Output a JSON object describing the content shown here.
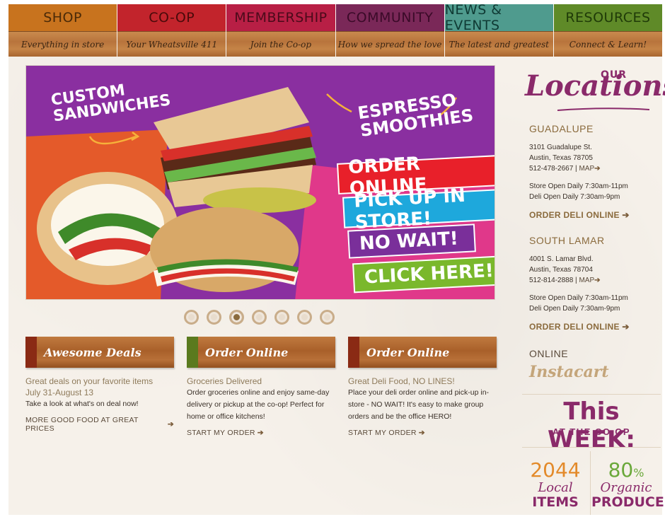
{
  "nav": [
    {
      "label": "SHOP",
      "sub": "Everything in store",
      "color": "#c8731e",
      "text_color": "#4a2a08"
    },
    {
      "label": "CO-OP",
      "sub": "Your Wheatsville 411",
      "color": "#c2242c",
      "text_color": "#4a0a0a"
    },
    {
      "label": "MEMBERSHIP",
      "sub": "Join the Co-op",
      "color": "#b81f45",
      "text_color": "#4a0a1a"
    },
    {
      "label": "COMMUNITY",
      "sub": "How we spread the love",
      "color": "#7a2858",
      "text_color": "#3a0a28"
    },
    {
      "label": "NEWS & EVENTS",
      "sub": "The latest and greatest",
      "color": "#4f9b8e",
      "text_color": "#0f3a34"
    },
    {
      "label": "RESOURCES",
      "sub": "Connect & Learn!",
      "color": "#5f8a28",
      "text_color": "#1f3a08"
    }
  ],
  "hero": {
    "left_text": "CUSTOM\nSANDWICHES",
    "right_text": "ESPRESSO\nSMOOTHIES",
    "bands": [
      {
        "label": "ORDER ONLINE",
        "color": "#e8202a"
      },
      {
        "label": "PICK UP IN STORE!",
        "color": "#1ea8dc"
      },
      {
        "label": "NO WAIT!",
        "color": "#7a2f9a"
      },
      {
        "label": "CLICK HERE!",
        "color": "#7ab82c"
      }
    ]
  },
  "carousel": {
    "count": 7,
    "active_index": 2
  },
  "features": [
    {
      "title": "Awesome Deals",
      "stripe_color": "#8a2a14",
      "subtitle": "Great deals on your favorite items",
      "date": "July 31-August 13",
      "desc": "Take a look at what's on deal now!",
      "link": "MORE GOOD FOOD AT GREAT PRICES"
    },
    {
      "title": "Order Online",
      "stripe_color": "#5a7a1e",
      "subtitle": "Groceries Delivered",
      "desc": "Order groceries online and enjoy same-day delivery or pickup at the co-op! Perfect for home or office kitchens!",
      "link": "START MY ORDER"
    },
    {
      "title": "Order Online",
      "stripe_color": "#8a2a14",
      "subtitle": "Great Deli Food, NO LINES!",
      "desc": "Place your deli order online and pick-up in-store - NO WAIT! It's easy to make group orders and be the office HERO!",
      "link": "START MY ORDER"
    }
  ],
  "sidebar": {
    "title_our": "OUR",
    "title_main": "Locations",
    "stores": [
      {
        "name": "GUADALUPE",
        "address1": "3101 Guadalupe St.",
        "address2": "Austin, Texas 78705",
        "phone": "512-478-2667",
        "map": "MAP",
        "hours_store": "Store Open Daily 7:30am-11pm",
        "hours_deli": "Deli Open Daily 7:30am-9pm",
        "order": "ORDER DELI ONLINE"
      },
      {
        "name": "SOUTH LAMAR",
        "address1": "4001 S. Lamar Blvd.",
        "address2": "Austin, Texas 78704",
        "phone": "512-814-2888",
        "map": "MAP",
        "hours_store": "Store Open Daily 7:30am-11pm",
        "hours_deli": "Deli Open Daily 7:30am-9pm",
        "order": "ORDER DELI ONLINE"
      }
    ],
    "online_label": "ONLINE",
    "instacart": "Instacart",
    "this_week": "This WEEK:",
    "this_week_sub": "AT THE CO-OP",
    "stats": [
      {
        "num": "2044",
        "num_suffix": "",
        "label1": "Local",
        "label2": "ITEMS",
        "color": "#e38a2a"
      },
      {
        "num": "80",
        "num_suffix": "%",
        "label1": "Organic",
        "label2": "PRODUCE",
        "color": "#6aa83a"
      }
    ]
  }
}
